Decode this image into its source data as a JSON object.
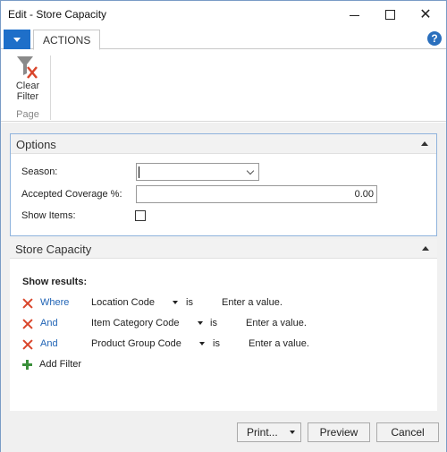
{
  "window": {
    "title": "Edit - Store Capacity"
  },
  "ribbon": {
    "tab_actions": "ACTIONS",
    "clear_filter_line1": "Clear",
    "clear_filter_line2": "Filter",
    "group_page": "Page"
  },
  "options": {
    "title": "Options",
    "season_label": "Season:",
    "season_value": "",
    "coverage_label": "Accepted Coverage %:",
    "coverage_value": "0.00",
    "show_items_label": "Show Items:",
    "show_items_checked": false
  },
  "store_capacity": {
    "title": "Store Capacity",
    "show_results": "Show results:",
    "filters": [
      {
        "conj": "Where",
        "field": "Location Code",
        "op": "is",
        "value": "Enter a value."
      },
      {
        "conj": "And",
        "field": "Item Category Code",
        "op": "is",
        "value": "Enter a value."
      },
      {
        "conj": "And",
        "field": "Product Group Code",
        "op": "is",
        "value": "Enter a value."
      }
    ],
    "add_filter": "Add Filter"
  },
  "buttons": {
    "print": "Print...",
    "preview": "Preview",
    "cancel": "Cancel"
  },
  "colors": {
    "accent": "#1e6fc9",
    "panel_border": "#8fb3dc",
    "remove_icon": "#d9452b",
    "add_icon": "#3a8f3a",
    "link": "#1f63b5"
  }
}
